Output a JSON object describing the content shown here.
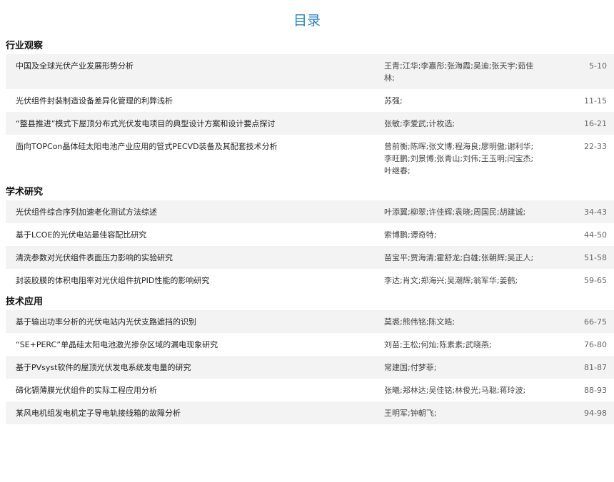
{
  "header": {
    "title": "目录"
  },
  "sections": [
    {
      "name": "行业观察",
      "items": [
        {
          "title": "中国及全球光伏产业发展形势分析",
          "authors": "王青;江华;李嘉彤;张海霞;吴迪;张天宇;茹佳林;",
          "pages": "5-10"
        },
        {
          "title": "光伏组件封装制造设备差异化管理的利弊浅析",
          "authors": "苏强;",
          "pages": "11-15"
        },
        {
          "title": "“整县推进”模式下屋顶分布式光伏发电项目的典型设计方案和设计要点探讨",
          "authors": "张敏;李爱武;计枚选;",
          "pages": "16-21"
        },
        {
          "title": "面向TOPCon晶体硅太阳电池产业应用的管式PECVD装备及其配套技术分析",
          "authors": "曾前衡;陈晖;张文博;程海良;廖明傲;谢利华;李旺鹏;刘景博;张青山;刘伟;王玉明;闫宝杰;叶继春;",
          "pages": "22-33"
        }
      ]
    },
    {
      "name": "学术研究",
      "items": [
        {
          "title": "光伏组件综合序列加速老化测试方法综述",
          "authors": "叶添翼;柳翠;许佳辉;袁晓;周国民;胡建诚;",
          "pages": "34-43"
        },
        {
          "title": "基于LCOE的光伏电站最佳容配比研究",
          "authors": "索博鹏;谭奇特;",
          "pages": "44-50"
        },
        {
          "title": "清洗参数对光伏组件表面压力影响的实验研究",
          "authors": "苗宝平;贾海清;霍舒龙;白雄;张朝辉;吴正人;",
          "pages": "51-58"
        },
        {
          "title": "封装胶膜的体积电阻率对光伏组件抗PID性能的影响研究",
          "authors": "李达;肖文;郑海兴;吴潮辉;翁军华;姜鹤;",
          "pages": "59-65"
        }
      ]
    },
    {
      "name": "技术应用",
      "items": [
        {
          "title": "基于输出功率分析的光伏电站内光伏支路遮挡的识别",
          "authors": "莫裘;熊伟铭;陈文皓;",
          "pages": "66-75"
        },
        {
          "title": "“SE+PERC”单晶硅太阳电池激光掺杂区域的漏电现象研究",
          "authors": "刘苗;王松;何灿;陈素素;武晓燕;",
          "pages": "76-80"
        },
        {
          "title": "基于PVsyst软件的屋顶光伏发电系统发电量的研究",
          "authors": "常建国;付梦菲;",
          "pages": "81-87"
        },
        {
          "title": "碲化镉薄膜光伏组件的实际工程应用分析",
          "authors": "张曦;郑林达;吴佳铭;林俊光;马聪;蒋玲波;",
          "pages": "88-93"
        },
        {
          "title": "某风电机组发电机定子导电轨接线箱的故障分析",
          "authors": "王明军;钟朝飞;",
          "pages": "94-98"
        }
      ]
    }
  ]
}
